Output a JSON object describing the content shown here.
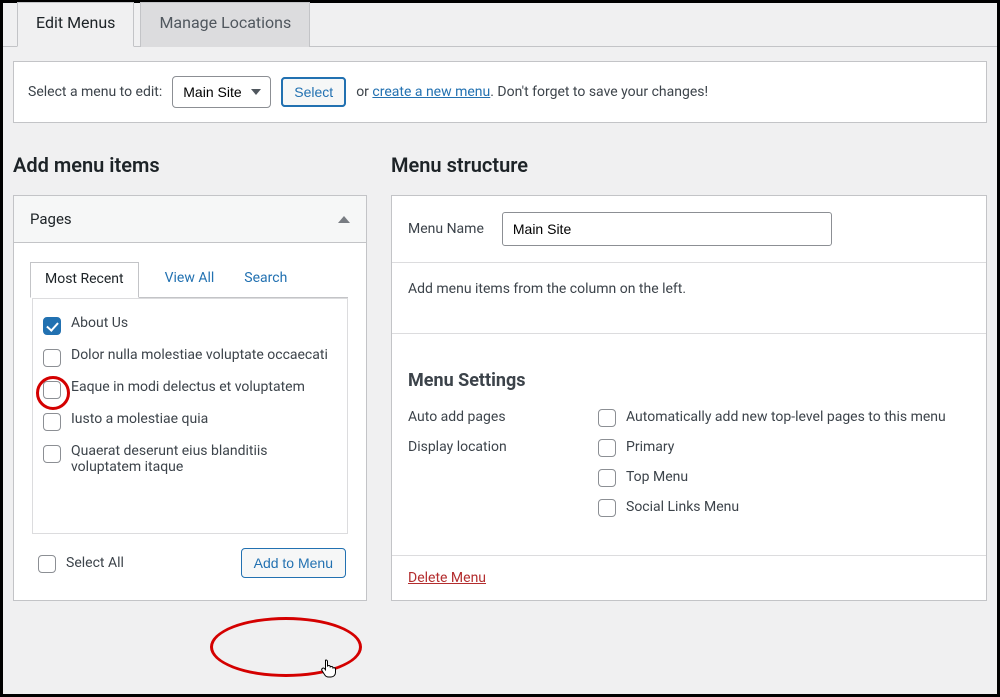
{
  "tabs": {
    "edit": "Edit Menus",
    "manage": "Manage Locations"
  },
  "selectBar": {
    "label": "Select a menu to edit:",
    "selected": "Main Site",
    "selectBtn": "Select",
    "or": "or",
    "createLink": "create a new menu",
    "tail": ". Don't forget to save your changes!"
  },
  "addItemsTitle": "Add menu items",
  "menuStructureTitle": "Menu structure",
  "pagesPanel": {
    "title": "Pages",
    "subtabs": {
      "recent": "Most Recent",
      "all": "View All",
      "search": "Search"
    },
    "items": [
      {
        "label": "About Us",
        "checked": true
      },
      {
        "label": "Dolor nulla molestiae voluptate occaecati",
        "checked": false
      },
      {
        "label": "Eaque in modi delectus et voluptatem",
        "checked": false
      },
      {
        "label": "Iusto a molestiae quia",
        "checked": false
      },
      {
        "label": "Quaerat deserunt eius blanditiis voluptatem itaque",
        "checked": false
      }
    ],
    "selectAll": "Select All",
    "addBtn": "Add to Menu"
  },
  "menuName": {
    "label": "Menu Name",
    "value": "Main Site"
  },
  "menuBodyHint": "Add menu items from the column on the left.",
  "menuSettings": {
    "title": "Menu Settings",
    "autoAddLabel": "Auto add pages",
    "autoAddOption": "Automatically add new top-level pages to this menu",
    "displayLabel": "Display location",
    "locations": [
      "Primary",
      "Top Menu",
      "Social Links Menu"
    ]
  },
  "deleteMenu": "Delete Menu"
}
